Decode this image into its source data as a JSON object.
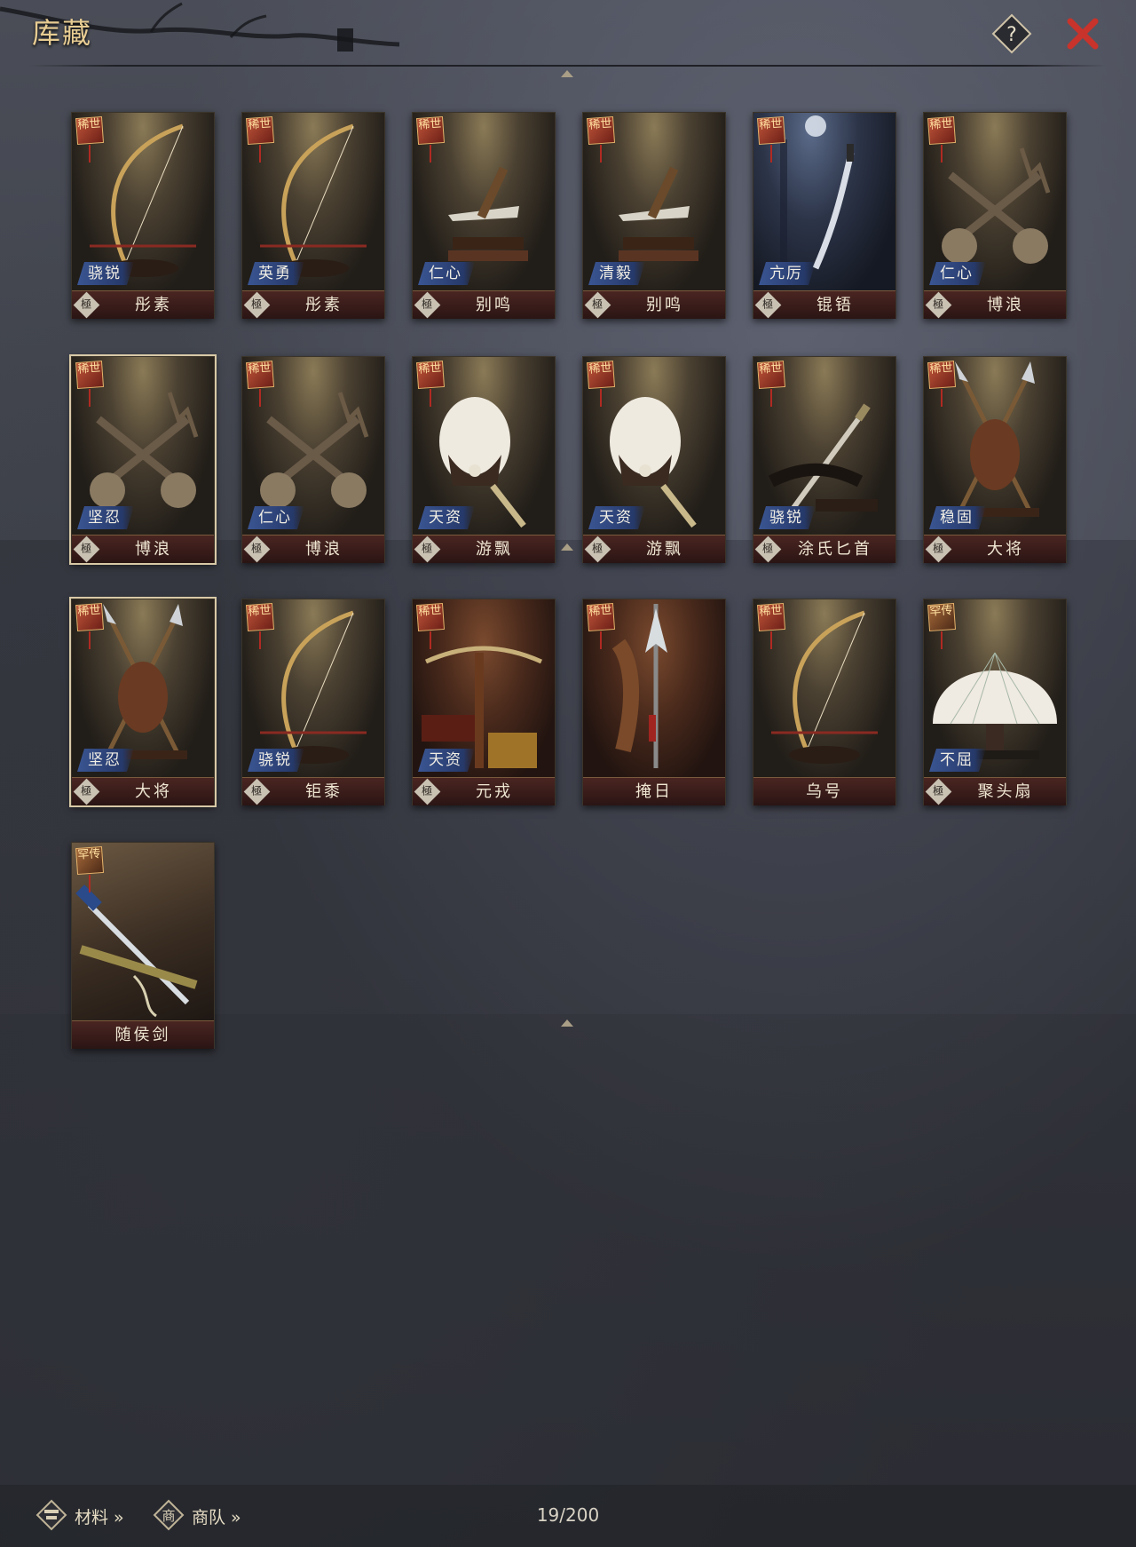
{
  "header": {
    "title": "库藏"
  },
  "grid": {
    "items": [
      {
        "rarity": "稀世",
        "trait": "骁锐",
        "name": "彤素",
        "grade": "極",
        "art": "bow"
      },
      {
        "rarity": "稀世",
        "trait": "英勇",
        "name": "彤素",
        "grade": "極",
        "art": "bow"
      },
      {
        "rarity": "稀世",
        "trait": "仁心",
        "name": "别鸣",
        "grade": "極",
        "art": "dagger"
      },
      {
        "rarity": "稀世",
        "trait": "清毅",
        "name": "别鸣",
        "grade": "極",
        "art": "dagger"
      },
      {
        "rarity": "稀世",
        "trait": "亢厉",
        "name": "锟铻",
        "grade": "極",
        "art": "sword"
      },
      {
        "rarity": "稀世",
        "trait": "仁心",
        "name": "博浪",
        "grade": "極",
        "art": "mace"
      },
      {
        "rarity": "稀世",
        "trait": "坚忍",
        "name": "博浪",
        "grade": "極",
        "art": "mace"
      },
      {
        "rarity": "稀世",
        "trait": "仁心",
        "name": "博浪",
        "grade": "極",
        "art": "mace"
      },
      {
        "rarity": "稀世",
        "trait": "天资",
        "name": "游飘",
        "grade": "極",
        "art": "fan"
      },
      {
        "rarity": "稀世",
        "trait": "天资",
        "name": "游飘",
        "grade": "極",
        "art": "fan"
      },
      {
        "rarity": "稀世",
        "trait": "骁锐",
        "name": "涂氏匕首",
        "grade": "極",
        "art": "knife"
      },
      {
        "rarity": "稀世",
        "trait": "稳固",
        "name": "大将",
        "grade": "極",
        "art": "spear"
      },
      {
        "rarity": "稀世",
        "trait": "坚忍",
        "name": "大将",
        "grade": "極",
        "art": "spear"
      },
      {
        "rarity": "稀世",
        "trait": "骁锐",
        "name": "钜黍",
        "grade": "極",
        "art": "bow"
      },
      {
        "rarity": "稀世",
        "trait": "天资",
        "name": "元戎",
        "grade": "極",
        "art": "crossbow"
      },
      {
        "rarity": "稀世",
        "trait": "",
        "name": "掩日",
        "grade": "",
        "art": "halberd"
      },
      {
        "rarity": "稀世",
        "trait": "",
        "name": "乌号",
        "grade": "",
        "art": "bow"
      },
      {
        "rarity": "罕传",
        "trait": "不屈",
        "name": "聚头扇",
        "grade": "極",
        "art": "bigfan"
      },
      {
        "rarity": "罕传",
        "trait": "",
        "name": "随侯剑",
        "grade": "",
        "art": "sword2"
      }
    ]
  },
  "footer": {
    "materials_label": "材料 »",
    "materials_icon": "materials-icon",
    "caravan_label": "商队 »",
    "caravan_icon": "caravan-icon",
    "count": "19/200"
  },
  "colors": {
    "title": "#e7cc92",
    "close": "#c8332b",
    "trait_badge": "#3a5592",
    "nameplate": "#4a2521"
  }
}
